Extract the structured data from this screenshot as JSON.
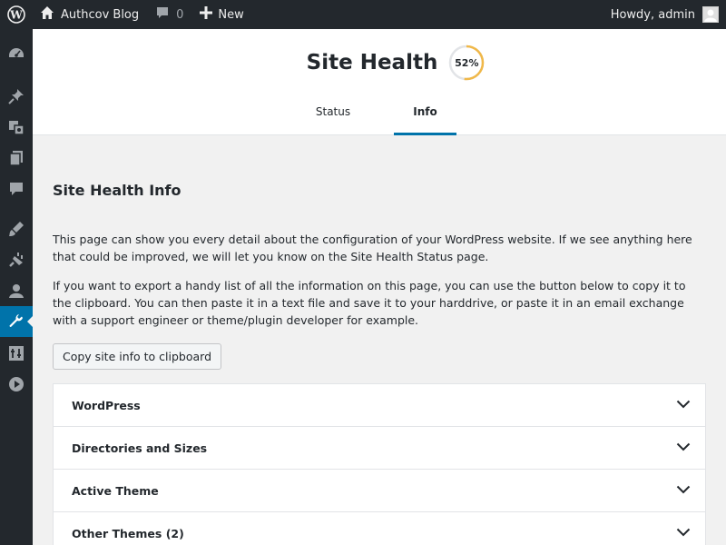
{
  "adminbar": {
    "site_name": "Authcov Blog",
    "comment_count": "0",
    "new_label": "New",
    "howdy": "Howdy, admin"
  },
  "sidebar": {
    "items": [
      {
        "icon": "dashboard-icon"
      },
      {
        "icon": "pin-icon"
      },
      {
        "icon": "media-icon"
      },
      {
        "icon": "pages-icon"
      },
      {
        "icon": "comments-icon"
      },
      {
        "icon": "appearance-icon"
      },
      {
        "icon": "plugins-icon"
      },
      {
        "icon": "users-icon"
      },
      {
        "icon": "tools-icon",
        "active": true
      },
      {
        "icon": "settings-icon"
      },
      {
        "icon": "media-play-icon"
      }
    ]
  },
  "header": {
    "title": "Site Health",
    "score": "52%",
    "score_value": 0.52,
    "tabs": [
      {
        "label": "Status"
      },
      {
        "label": "Info",
        "active": true
      }
    ]
  },
  "main": {
    "section_title": "Site Health Info",
    "desc1": "This page can show you every detail about the configuration of your WordPress website. If we see anything here that could be improved, we will let you know on the Site Health Status page.",
    "desc2": "If you want to export a handy list of all the information on this page, you can use the button below to copy it to the clipboard. You can then paste it in a text file and save it to your harddrive, or paste it in an email exchange with a support engineer or theme/plugin developer for example.",
    "copy_button": "Copy site info to clipboard",
    "sections": [
      {
        "label": "WordPress"
      },
      {
        "label": "Directories and Sizes"
      },
      {
        "label": "Active Theme"
      },
      {
        "label": "Other Themes (2)"
      }
    ]
  },
  "colors": {
    "adminbar_bg": "#23282d",
    "accent": "#0073aa",
    "score_ring": "#f0b849",
    "page_bg": "#f1f1f1"
  }
}
